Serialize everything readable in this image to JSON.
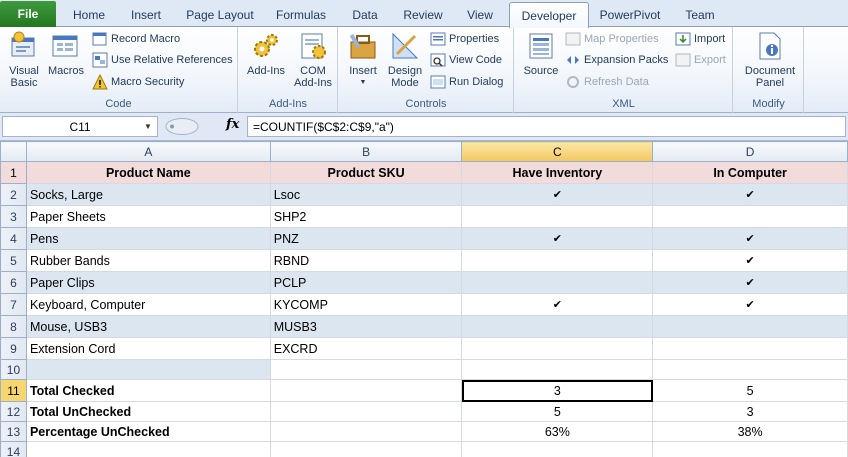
{
  "ribbon_tabs": [
    "File",
    "Home",
    "Insert",
    "Page Layout",
    "Formulas",
    "Data",
    "Review",
    "View",
    "Developer",
    "PowerPivot",
    "Team"
  ],
  "active_tab": "Developer",
  "groups": {
    "code": {
      "label": "Code",
      "visual_basic": "Visual Basic",
      "macros": "Macros",
      "record_macro": "Record Macro",
      "use_relative": "Use Relative References",
      "macro_security": "Macro Security"
    },
    "addins": {
      "label": "Add-Ins",
      "addins_btn": "Add-Ins",
      "com_addins": "COM Add-Ins"
    },
    "controls": {
      "label": "Controls",
      "insert": "Insert",
      "design_mode": "Design Mode",
      "properties": "Properties",
      "view_code": "View Code",
      "run_dialog": "Run Dialog"
    },
    "xml": {
      "label": "XML",
      "source": "Source",
      "map_properties": "Map Properties",
      "expansion_packs": "Expansion Packs",
      "refresh_data": "Refresh Data",
      "import": "Import",
      "export": "Export"
    },
    "modify": {
      "label": "Modify",
      "document_panel": "Document Panel"
    }
  },
  "formula_bar": {
    "name_box": "C11",
    "fx": "fx",
    "formula": "=COUNTIF($C$2:C$9,\"a\")"
  },
  "sheet": {
    "columns": [
      "A",
      "B",
      "C",
      "D"
    ],
    "selected_column": "C",
    "selected_row": 11,
    "header": [
      "Product Name",
      "Product SKU",
      "Have Inventory",
      "In Computer"
    ],
    "rows": [
      {
        "row": 2,
        "name": "Socks, Large",
        "sku": "Lsoc",
        "inv": "✔",
        "comp": "✔"
      },
      {
        "row": 3,
        "name": "Paper Sheets",
        "sku": "SHP2",
        "inv": "",
        "comp": ""
      },
      {
        "row": 4,
        "name": "Pens",
        "sku": "PNZ",
        "inv": "✔",
        "comp": "✔"
      },
      {
        "row": 5,
        "name": "Rubber Bands",
        "sku": "RBND",
        "inv": "",
        "comp": "✔"
      },
      {
        "row": 6,
        "name": "Paper Clips",
        "sku": "PCLP",
        "inv": "",
        "comp": "✔"
      },
      {
        "row": 7,
        "name": "Keyboard, Computer",
        "sku": "KYCOMP",
        "inv": "✔",
        "comp": "✔"
      },
      {
        "row": 8,
        "name": "Mouse, USB3",
        "sku": "MUSB3",
        "inv": "",
        "comp": ""
      },
      {
        "row": 9,
        "name": "Extension Cord",
        "sku": "EXCRD",
        "inv": "",
        "comp": ""
      },
      {
        "row": 10,
        "name": "",
        "sku": "",
        "inv": "",
        "comp": ""
      }
    ],
    "summary": [
      {
        "row": 11,
        "label": "Total Checked",
        "c": "3",
        "d": "5"
      },
      {
        "row": 12,
        "label": "Total UnChecked",
        "c": "5",
        "d": "3"
      },
      {
        "row": 13,
        "label": "Percentage UnChecked",
        "c": "63%",
        "d": "38%"
      },
      {
        "row": 14,
        "label": "",
        "c": "",
        "d": ""
      }
    ]
  }
}
